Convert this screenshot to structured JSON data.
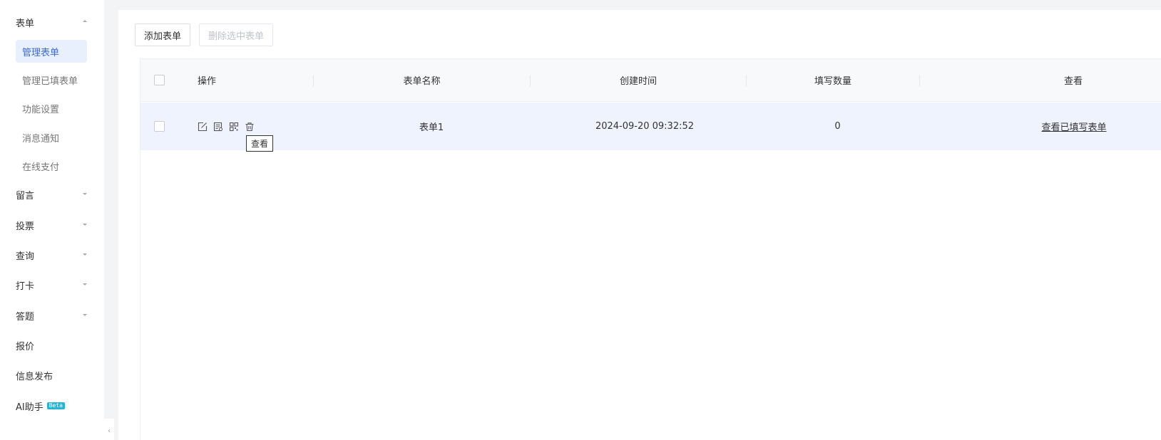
{
  "sidebar": {
    "groups": [
      {
        "label": "表单",
        "expanded": true
      },
      {
        "label": "留言"
      },
      {
        "label": "投票"
      },
      {
        "label": "查询"
      },
      {
        "label": "打卡"
      },
      {
        "label": "答题"
      },
      {
        "label": "报价"
      },
      {
        "label": "信息发布"
      },
      {
        "label": "AI助手",
        "badge": "Beta"
      }
    ],
    "form_sub_items": [
      {
        "label": "管理表单",
        "active": true
      },
      {
        "label": "管理已填表单"
      },
      {
        "label": "功能设置"
      },
      {
        "label": "消息通知"
      },
      {
        "label": "在线支付"
      }
    ]
  },
  "toolbar": {
    "add_label": "添加表单",
    "delete_label": "删除选中表单"
  },
  "table": {
    "columns": [
      "操作",
      "表单名称",
      "创建时间",
      "填写数量",
      "查看"
    ],
    "rows": [
      {
        "name": "表单1",
        "created": "2024-09-20 09:32:52",
        "count": "0",
        "view_link": "查看已填写表单"
      }
    ]
  },
  "tooltip": "查看",
  "colors": {
    "accent": "#3f6ad8",
    "active_bg": "#e8f0fe",
    "row_highlight": "#eef3fd",
    "beta_badge": "#1fb6d9"
  }
}
